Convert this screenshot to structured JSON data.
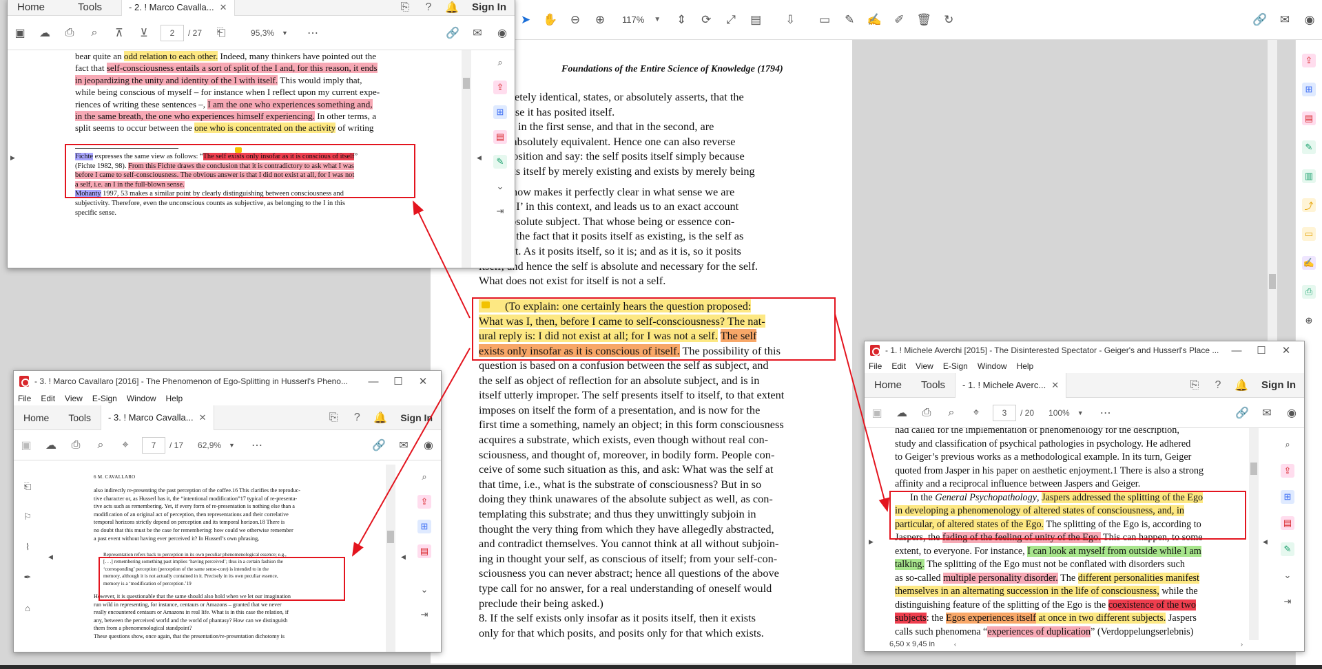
{
  "main_toolbar": {
    "zoom": "117%"
  },
  "main_page": {
    "header": "Foundations of the Entire Science of Knowledge (1794)",
    "lines": [
      "e completely identical, states, or absolutely asserts, that the",
      "ts because it has posited itself.",
      "The self in the first sense, and that in the second, are",
      "d to be absolutely equivalent. Hence one can also reverse",
      "ve proposition and say: the self posits itself simply because",
      ". It posits itself by merely existing and exists by merely being",
      "nd this now makes it perfectly clear in what sense we are",
      "e word ‘I’ in this context, and leads us to an exact account",
      "elf as absolute subject. That whose being or essence con-",
      "mply in the fact that it posits itself as existing, is the self as",
      "e subject. As it posits itself, so it is; and as it is, so it posits",
      "itself; and hence the self is absolute and necessary for the self.",
      "What does not exist for itself is not a self."
    ],
    "hl_para": {
      "a": "(To explain: one certainly hears the question proposed:",
      "b": "What was I, then, before I came to self-consciousness? The nat-",
      "c": "ural reply is: I did not exist at all; for I was not a self.",
      "d": "The self",
      "e": "exists only insofar as it is conscious of itself.",
      "f": "The possibility of this"
    },
    "lines2": [
      "question is based on a confusion between the self as subject, and",
      "the self as object of reflection for an absolute subject, and is in",
      "itself utterly improper. The self presents itself to itself, to that extent",
      "imposes on itself the form of a presentation, and is now for the",
      "first time a something, namely an object; in this form consciousness",
      "acquires a substrate, which exists, even though without real con-",
      "sciousness, and thought of, moreover, in bodily form. People con-",
      "ceive of some such situation as this, and ask: What was the self at",
      "that time, i.e., what is the substrate of consciousness? But in so",
      "doing they think unawares of the absolute subject as well, as con-",
      "templating this substrate; and thus they unwittingly subjoin in",
      "thought the very thing from which they have allegedly abstracted,",
      "and contradict themselves. You cannot think at all without subjoin-",
      "ing in thought your self, as conscious of itself; from your self-con-",
      "sciousness you can never abstract; hence all questions of the above",
      "type call for no answer, for a real understanding of oneself would",
      "preclude their being asked.)",
      "8.  If the self exists only insofar as it posits itself, then it exists",
      "only for that which posits, and posits only for that which exists."
    ]
  },
  "win2": {
    "tabs": {
      "home": "Home",
      "tools": "Tools",
      "doc": "- 2. ! Marco Cavalla...",
      "signin": "Sign In"
    },
    "page_num": "2",
    "page_total": "/ 27",
    "zoom": "95,3%",
    "text": {
      "l1a": "bear quite an ",
      "l1b": "odd relation to each other.",
      "l1c": " Indeed, many thinkers have pointed out the",
      "l2a": "fact that ",
      "l2b": "self-consciousness entails a sort of split of the I and, for this reason, it ends",
      "l3": "in jeopardizing the unity and identity of the I with itself.",
      "l3b": " This would imply that,",
      "l4": "while being conscious of myself – for instance when I reflect upon my current expe-",
      "l5a": "riences of writing these sentences –, ",
      "l5b": "I am the one who experiences something and,",
      "l6a": "in the same breath, the one who experiences himself experiencing.",
      "l6b": " In other terms, a",
      "l7a": "split seems to occur between the ",
      "l7b": "one who is concentrated on the activity",
      "l7c": " of writing",
      "fn1a": "Fichte",
      "fn1b": " expresses the same view as follows: “",
      "fn1c": "The self exists only insofar as it is conscious of itself",
      "fn1d": "(Fichte 1982, 98). ",
      "fn1e": "From this Fichte draws the conclusion that it is contradictory to ask what I was",
      "fn1f": "before I came to self-consciousness. The obvious answer is that I did not exist at all, for I was not",
      "fn1g": "a self, i.e. an I in the full-blown sense.",
      "fn2a": "Mohanty",
      "fn2b": " 1997, 53 makes a similar point by clearly distinguishing between consciousness and",
      "fn2c": "subjectivity. Therefore, even the unconscious counts as subjective, as belonging to the I in this",
      "fn2d": "specific sense."
    }
  },
  "win3": {
    "title": "- 3. ! Marco Cavallaro [2016] - The Phenomenon of Ego-Splitting in Husserl's Pheno...",
    "menu": [
      "File",
      "Edit",
      "View",
      "E-Sign",
      "Window",
      "Help"
    ],
    "tabs": {
      "home": "Home",
      "tools": "Tools",
      "doc": "- 3. ! Marco Cavalla...",
      "signin": "Sign In"
    },
    "page_num": "7",
    "page_total": "/ 17",
    "zoom": "62,9%",
    "text": {
      "hdr": "6   M. CAVALLARO",
      "p1": [
        "also indirectly re-presenting the past perception of the coffee.16 This clarifies the reproduc-",
        "tive character or, as Husserl has it, the “intentional modification”17 typical of re-presenta-",
        "tive acts such as remembering. Yet, if every form of re-presentation is nothing else than a",
        "modification of an original act of perception, then representations and their correlative",
        "temporal horizons strictly depend on perception and its temporal horizon.18 There is",
        "no doubt that this must be the case for remembering: how could we otherwise remember",
        "a past event without having ever perceived it? In Husserl’s own phrasing,"
      ],
      "quote": [
        "Representation refers back to perception in its own peculiar phenomenological essence; e.g.,",
        "[. . .] remembering something past implies ‘having perceived’; thus in a certain fashion the",
        "‘corresponding’ perception (perception of the same sense-core) is intended to in the",
        "memory, although it is not actually contained in it. Precisely in its own peculiar essence,",
        "memory is a ‘modification of perception.’19"
      ],
      "p2": [
        "However, it is questionable that the same should also hold when we let our imagination",
        "run wild in representing, for instance, centaurs or Amazons – granted that we never",
        "really encountered centaurs or Amazons in real life. What is in this case the relation, if",
        "any, between the perceived world and the world of phantasy? How can we distinguish",
        "them from a phenomenological standpoint?",
        "   These questions show, once again, that the presentation/re-presentation dichotomy is"
      ]
    }
  },
  "win1": {
    "title": "- 1. ! Michele Averchi [2015] - The Disinterested Spectator - Geiger's and Husserl's Place ...",
    "menu": [
      "File",
      "Edit",
      "View",
      "E-Sign",
      "Window",
      "Help"
    ],
    "tabs": {
      "home": "Home",
      "tools": "Tools",
      "doc": "- 1. ! Michele Averc...",
      "signin": "Sign In"
    },
    "page_num": "3",
    "page_total": "/ 20",
    "zoom": "100%",
    "status": "6,50 x 9,45 in",
    "text": {
      "t1": "had called for the implementation of phenomenology for the description,",
      "t2": "study and classification of psychical pathologies in psychology. He adhered",
      "t3": "to Geiger’s previous works as a methodological example. In its turn, Geiger",
      "t4": "quoted from Jasper in his paper on aesthetic enjoyment.1 There is also a strong",
      "t5": "affinity and a reciprocal influence between Jaspers and Geiger.",
      "p1a": "In the ",
      "p1b": "General Psychopathology",
      "p1c": ", ",
      "p1d": "Jaspers addressed the splitting of the Ego",
      "p2": "in developing a phenomenology of altered states of consciousness, and, in",
      "p3a": "particular, of altered states of the Ego.",
      "p3b": " The splitting of the Ego is, according to",
      "p4a": "Jaspers, the ",
      "p4b": "fading of the feeling of unity of the Ego.",
      "p4c": " This can happen, to some",
      "p5a": "extent, to everyone. For instance, ",
      "p5b": "I can look at myself from outside while I am",
      "p6a": "talking.",
      "p6b": " The splitting of the Ego must not be conflated with disorders such",
      "p7a": "as so-called ",
      "p7b": "multiple personality disorder.",
      "p7c": " The ",
      "p7d": "different personalities manifest",
      "p8a": "themselves in an alternating succession in the life of consciousness,",
      "p8b": " while the",
      "p9a": "distinguishing feature of the splitting of the Ego is the ",
      "p9b": "coexistence of the two",
      "p10a": "subjects",
      "p10b": ": the ",
      "p10c": "Egos experiences itself",
      "p10d": " at once in two different subjects.",
      "p10e": " Jaspers",
      "p11a": "calls such phenomena “",
      "p11b": "experiences of duplication",
      "p11c": "” (Verdoppelungserlebnis)"
    }
  },
  "colors": {
    "highlight_yellow": "#fde883",
    "highlight_pink": "#f7a9b5",
    "highlight_red": "#ee3e4e",
    "highlight_green": "#a7e58c",
    "highlight_orange": "#f8a768",
    "annotation_red": "#e3141e"
  }
}
